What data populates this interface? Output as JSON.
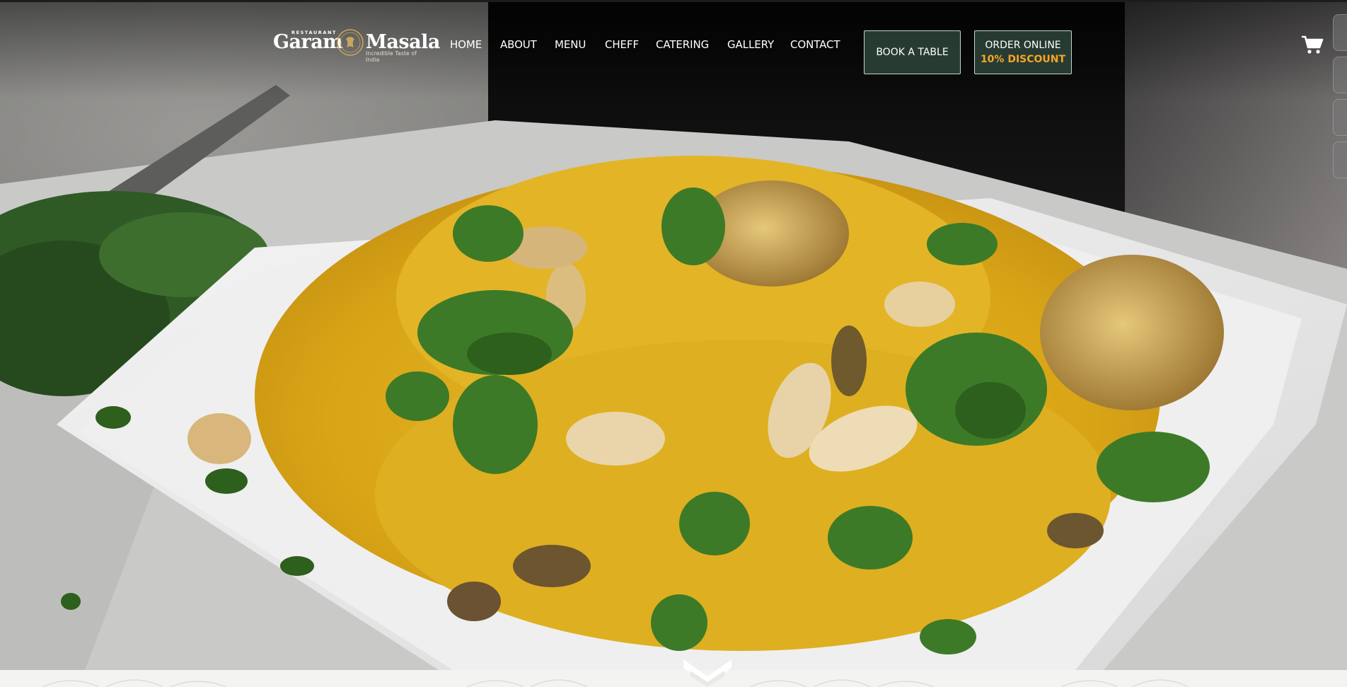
{
  "brand": {
    "restaurant_label": "RESTAURANT",
    "name_left": "Garam",
    "name_right": "Masala",
    "tagline": "Incredible Taste of India",
    "accent_color": "#f5a623"
  },
  "nav": {
    "items": [
      {
        "label": "HOME"
      },
      {
        "label": "ABOUT"
      },
      {
        "label": "MENU"
      },
      {
        "label": "CHEFF"
      },
      {
        "label": "CATERING"
      },
      {
        "label": "GALLERY"
      },
      {
        "label": "CONTACT"
      }
    ]
  },
  "actions": {
    "book_table": "BOOK A TABLE",
    "order_online": "ORDER ONLINE",
    "order_discount": "10% DISCOUNT",
    "button_color": "#2c443a"
  },
  "icons": {
    "cart": "shopping-cart-icon",
    "scroll": "chevron-down-icon"
  },
  "hero": {
    "image": "biryani-dish-photo"
  }
}
